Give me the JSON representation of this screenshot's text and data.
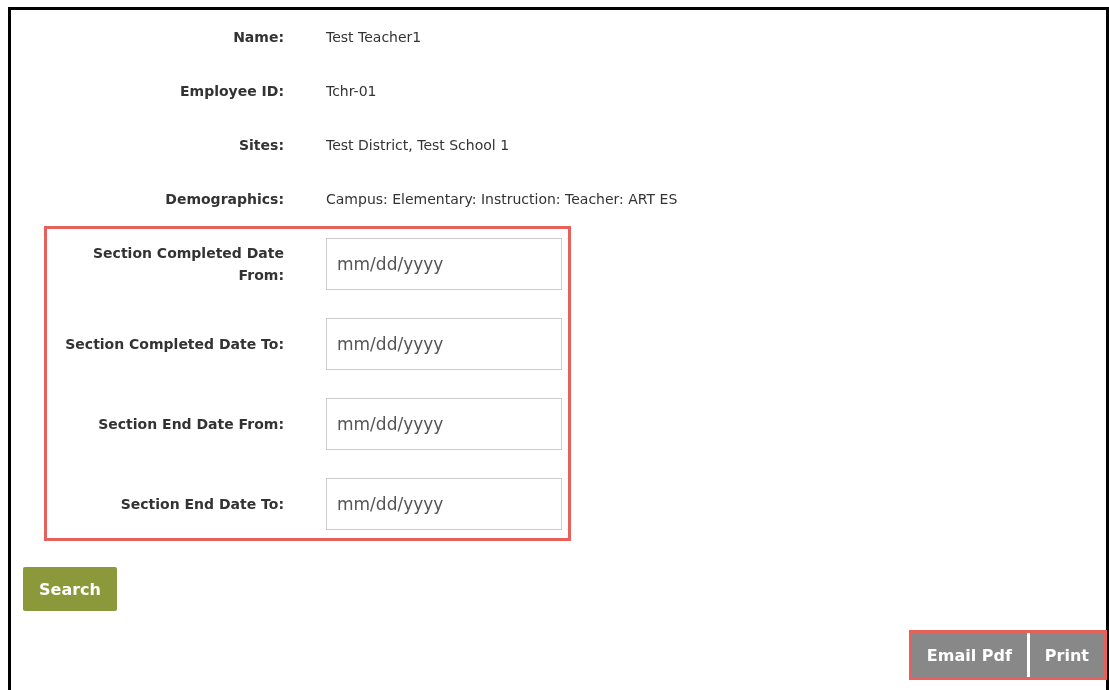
{
  "profile": [
    {
      "label": "Name:",
      "value": "Test Teacher1"
    },
    {
      "label": "Employee ID:",
      "value": "Tchr-01"
    },
    {
      "label": "Sites:",
      "value": "Test District, Test School 1"
    },
    {
      "label": "Demographics:",
      "value": "Campus: Elementary: Instruction: Teacher: ART ES"
    }
  ],
  "date_filters": [
    {
      "label": "Section Completed Date From:",
      "placeholder": "mm/dd/yyyy"
    },
    {
      "label": "Section Completed Date To:",
      "placeholder": "mm/dd/yyyy"
    },
    {
      "label": "Section End Date From:",
      "placeholder": "mm/dd/yyyy"
    },
    {
      "label": "Section End Date To:",
      "placeholder": "mm/dd/yyyy"
    }
  ],
  "search_button": "Search",
  "actions": [
    "Email Pdf",
    "Print"
  ]
}
